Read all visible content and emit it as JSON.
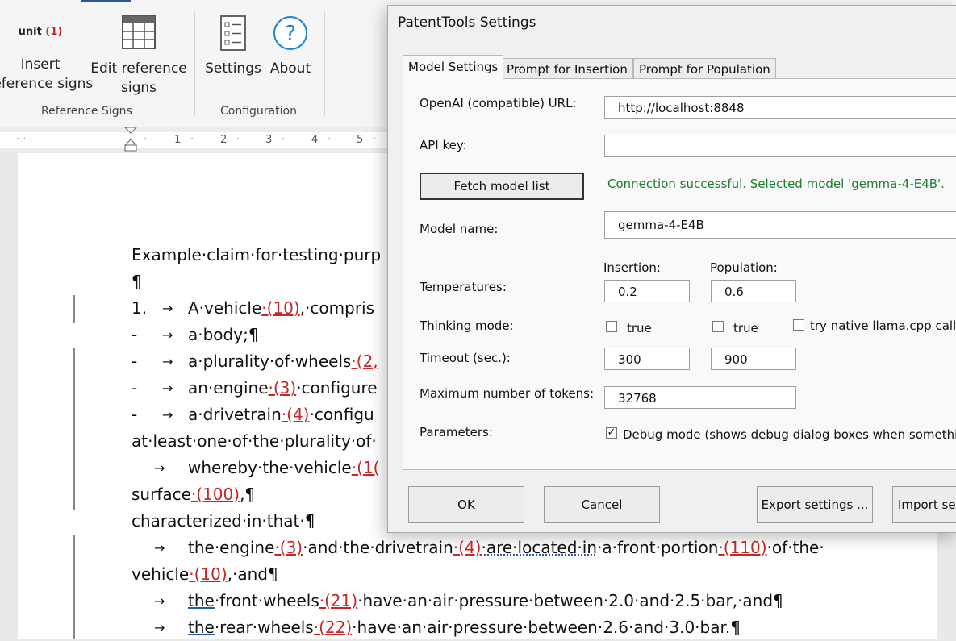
{
  "ribbon": {
    "insert_icon_text": "unit",
    "insert_icon_count": "(1)",
    "insert_line1": "Insert",
    "insert_line2": "reference signs",
    "edit_line1": "Edit reference",
    "edit_line2": "signs",
    "settings_label": "Settings",
    "about_label": "About",
    "group_reference_signs": "Reference Signs",
    "group_configuration": "Configuration"
  },
  "ruler": {
    "numbers": [
      "1",
      "2",
      "3",
      "4",
      "5"
    ]
  },
  "document": {
    "l1": "Example·claim·for·testing·purp",
    "l2": "¶",
    "l3_num": "1.",
    "l3_arrow": "→",
    "l3_text": "A·vehicle",
    "l3_ref": "·(10)",
    "l3_rest": ",·compris",
    "l4_dash": "-",
    "l4_arrow": "→",
    "l4_text": "a·body;¶",
    "l5_dash": "-",
    "l5_arrow": "→",
    "l5_text": "a·plurality·of·wheels",
    "l5_ref": "·(2,",
    "l6_dash": "-",
    "l6_arrow": "→",
    "l6_text": "an·engine",
    "l6_ref": "·(3)",
    "l6_rest": "·configure",
    "l7_dash": "-",
    "l7_arrow": "→",
    "l7_text": "a·drivetrain",
    "l7_ref": "·(4)",
    "l7_rest": "·configu",
    "l8": "at·least·one·of·the·plurality·of·",
    "l9_arrow": "→",
    "l9_text": "whereby·the·vehicle",
    "l9_ref": "·(1(",
    "l10_text": "surface",
    "l10_ref": "·(100)",
    "l10_rest": ",¶",
    "l11": "characterized·in·that·¶",
    "l12_arrow": "→",
    "l12_a": "the·engine",
    "l12_ref1": "·(3)",
    "l12_b": "·and·the·drivetrain",
    "l12_ref2": "·(4)",
    "l12_c": "·are·located·in",
    "l12_d": "·a·front·portion",
    "l12_ref3": "·(110)",
    "l12_e": "·of·the·",
    "l13_a": "vehicle",
    "l13_ref": "·(10)",
    "l13_b": ",·and¶",
    "l14_arrow": "→",
    "l14_a": "the",
    "l14_b": "·front·wheels",
    "l14_ref": "·(21)",
    "l14_c": "·have·an·air·pressure·between·2.0·and·2.5·bar,·and¶",
    "l15_arrow": "→",
    "l15_a": "the",
    "l15_b": "·rear·wheels",
    "l15_ref": "·(22)",
    "l15_c": "·have·an·air·pressure·between·2.6·and·3.0·bar.¶"
  },
  "dialog": {
    "title": "PatentTools Settings",
    "tabs": [
      "Model Settings",
      "Prompt for Insertion",
      "Prompt for Population"
    ],
    "url_label": "OpenAI (compatible) URL:",
    "url_value": "http://localhost:8848",
    "apikey_label": "API key:",
    "apikey_value": "",
    "fetch_button": "Fetch model list",
    "status": "Connection successful. Selected model 'gemma-4-E4B'.",
    "model_label": "Model name:",
    "model_value": "gemma-4-E4B",
    "insertion_header": "Insertion:",
    "population_header": "Population:",
    "temperatures_label": "Temperatures:",
    "temp_insertion": "0.2",
    "temp_population": "0.6",
    "thinking_label": "Thinking mode:",
    "thinking_insertion": "true",
    "thinking_population": "true",
    "native_llama": "try native llama.cpp call p",
    "timeout_label": "Timeout (sec.):",
    "timeout_insertion": "300",
    "timeout_population": "900",
    "maxtokens_label": "Maximum number of tokens:",
    "maxtokens_value": "32768",
    "parameters_label": "Parameters:",
    "debug_label": "Debug mode (shows debug dialog boxes when something",
    "debug_checked": "✓",
    "ok_button": "OK",
    "cancel_button": "Cancel",
    "export_button": "Export settings ...",
    "import_button": "Import set"
  }
}
